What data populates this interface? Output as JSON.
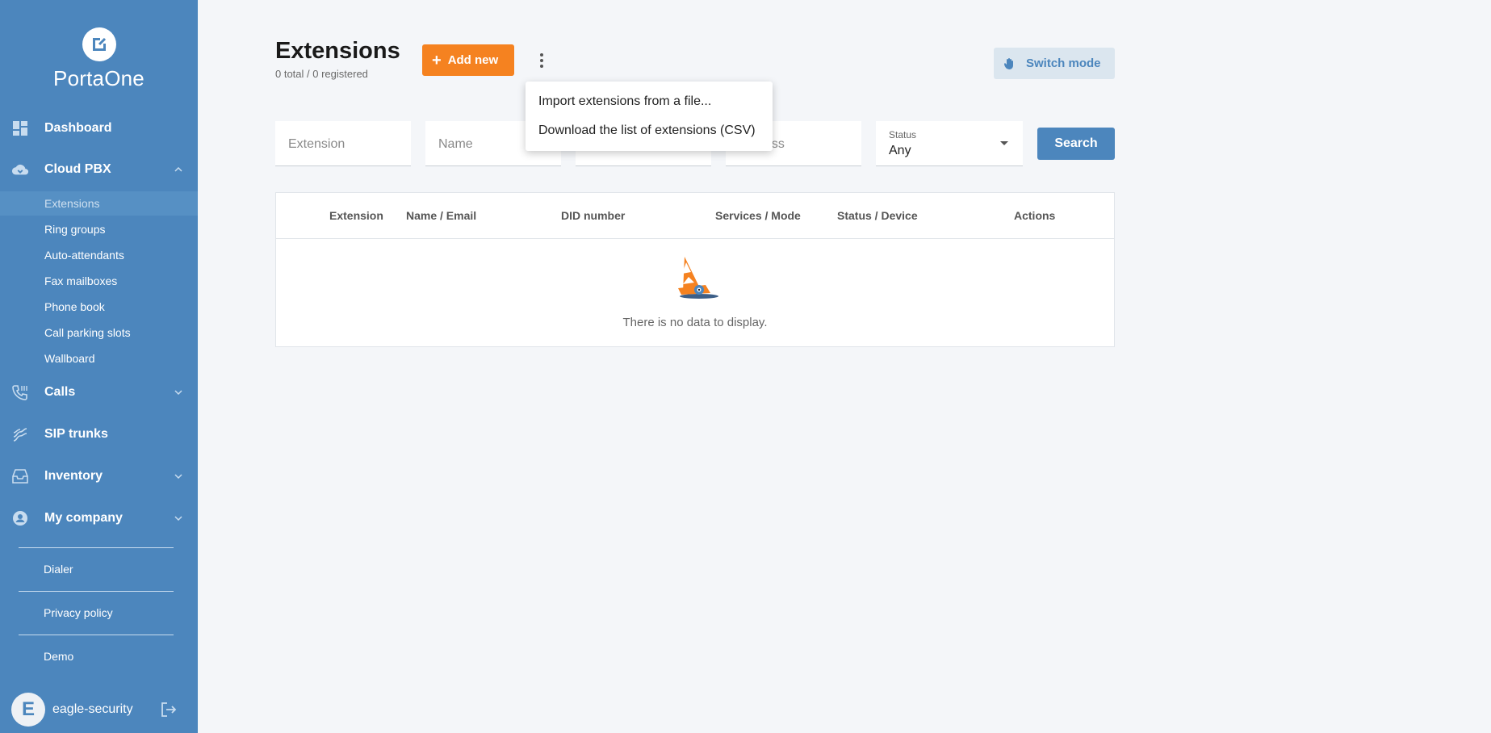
{
  "sidebar": {
    "brand": "PortaOne",
    "nav": {
      "dashboard": "Dashboard",
      "cloud_pbx": "Cloud PBX",
      "calls": "Calls",
      "sip_trunks": "SIP trunks",
      "inventory": "Inventory",
      "my_company": "My company"
    },
    "sub": {
      "extensions": "Extensions",
      "ring_groups": "Ring groups",
      "auto_attendants": "Auto-attendants",
      "fax_mailboxes": "Fax mailboxes",
      "phone_book": "Phone book",
      "call_parking_slots": "Call parking slots",
      "wallboard": "Wallboard"
    },
    "footer": {
      "dialer": "Dialer",
      "privacy_policy": "Privacy policy",
      "demo": "Demo"
    },
    "user": {
      "initial": "E",
      "name": "eagle-security"
    }
  },
  "header": {
    "title": "Extensions",
    "subtitle": "0 total / 0 registered",
    "add_new": "Add new",
    "switch_mode": "Switch mode"
  },
  "menu": {
    "import": "Import extensions from a file...",
    "download": "Download the list of extensions (CSV)"
  },
  "filters": {
    "extension_placeholder": "Extension",
    "name_placeholder": "Name",
    "ip_placeholder": "address",
    "status_label": "Status",
    "status_value": "Any",
    "search": "Search"
  },
  "table": {
    "columns": [
      "Extension",
      "Name / Email",
      "DID number",
      "Services / Mode",
      "Status / Device",
      "Actions"
    ],
    "empty": "There is no data to display."
  },
  "colors": {
    "sidebar": "#4c86bd",
    "accent": "#f58220",
    "background": "#f4f6f9"
  }
}
